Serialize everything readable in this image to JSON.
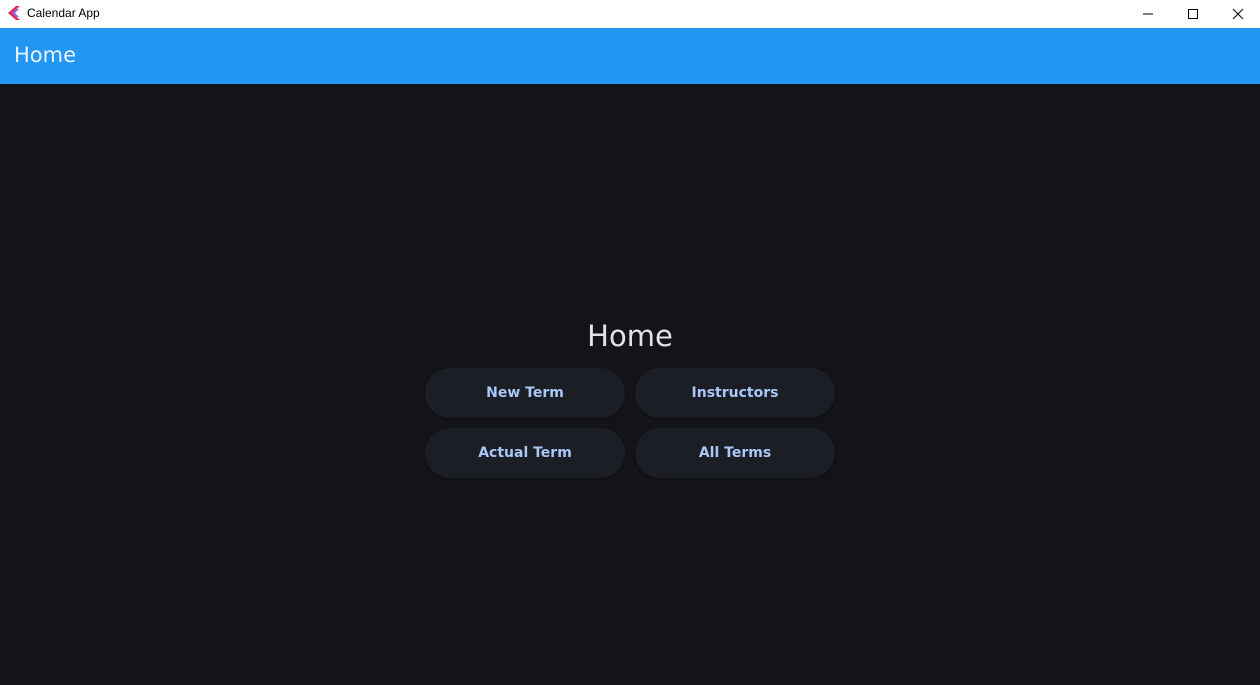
{
  "window": {
    "title": "Calendar App",
    "controls": {
      "minimize_icon": "minimize-icon",
      "maximize_icon": "maximize-icon",
      "close_icon": "close-icon"
    }
  },
  "appbar": {
    "title": "Home",
    "color": "#2196F3"
  },
  "main": {
    "heading": "Home",
    "buttons": [
      {
        "label": "New Term"
      },
      {
        "label": "Instructors"
      },
      {
        "label": "Actual Term"
      },
      {
        "label": "All Terms"
      }
    ]
  },
  "colors": {
    "background": "#121419",
    "button_bg": "#1b1e24",
    "button_text": "#a9c8f8"
  }
}
